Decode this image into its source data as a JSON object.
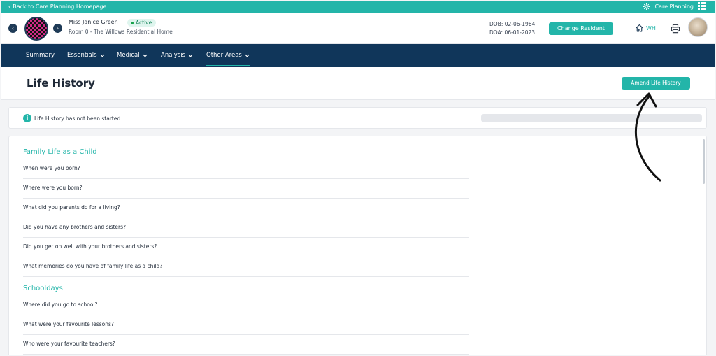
{
  "topbar": {
    "back_label": "Back to Care Planning Homepage",
    "app_label": "Care Planning"
  },
  "resident": {
    "name": "Miss Janice Green",
    "status": "Active",
    "room": "Room 0 - The Willows Residential Home",
    "dob": "DOB: 02-06-1964",
    "doa": "DOA: 06-01-2023",
    "change_button": "Change Resident",
    "home_label": "WH"
  },
  "nav": {
    "items": [
      {
        "label": "Summary"
      },
      {
        "label": "Essentials"
      },
      {
        "label": "Medical"
      },
      {
        "label": "Analysis"
      },
      {
        "label": "Other Areas"
      }
    ]
  },
  "page": {
    "title": "Life History",
    "amend_button": "Amend Life History",
    "info_text": "Life History has not been started"
  },
  "sections": [
    {
      "title": "Family Life as a Child",
      "questions": [
        "When were you born?",
        "Where were you born?",
        "What did you parents do for a living?",
        "Did you have any brothers and sisters?",
        "Did you get on well with your brothers and sisters?",
        "What memories do you have of family life as a child?"
      ]
    },
    {
      "title": "Schooldays",
      "questions": [
        "Where did you go to school?",
        "What were your favourite lessons?",
        "Who were your favourite teachers?"
      ]
    }
  ],
  "colors": {
    "accent": "#23b5a9",
    "navy": "#10365a",
    "active_badge_bg": "#dff5ee",
    "active_badge_text": "#16855a"
  }
}
